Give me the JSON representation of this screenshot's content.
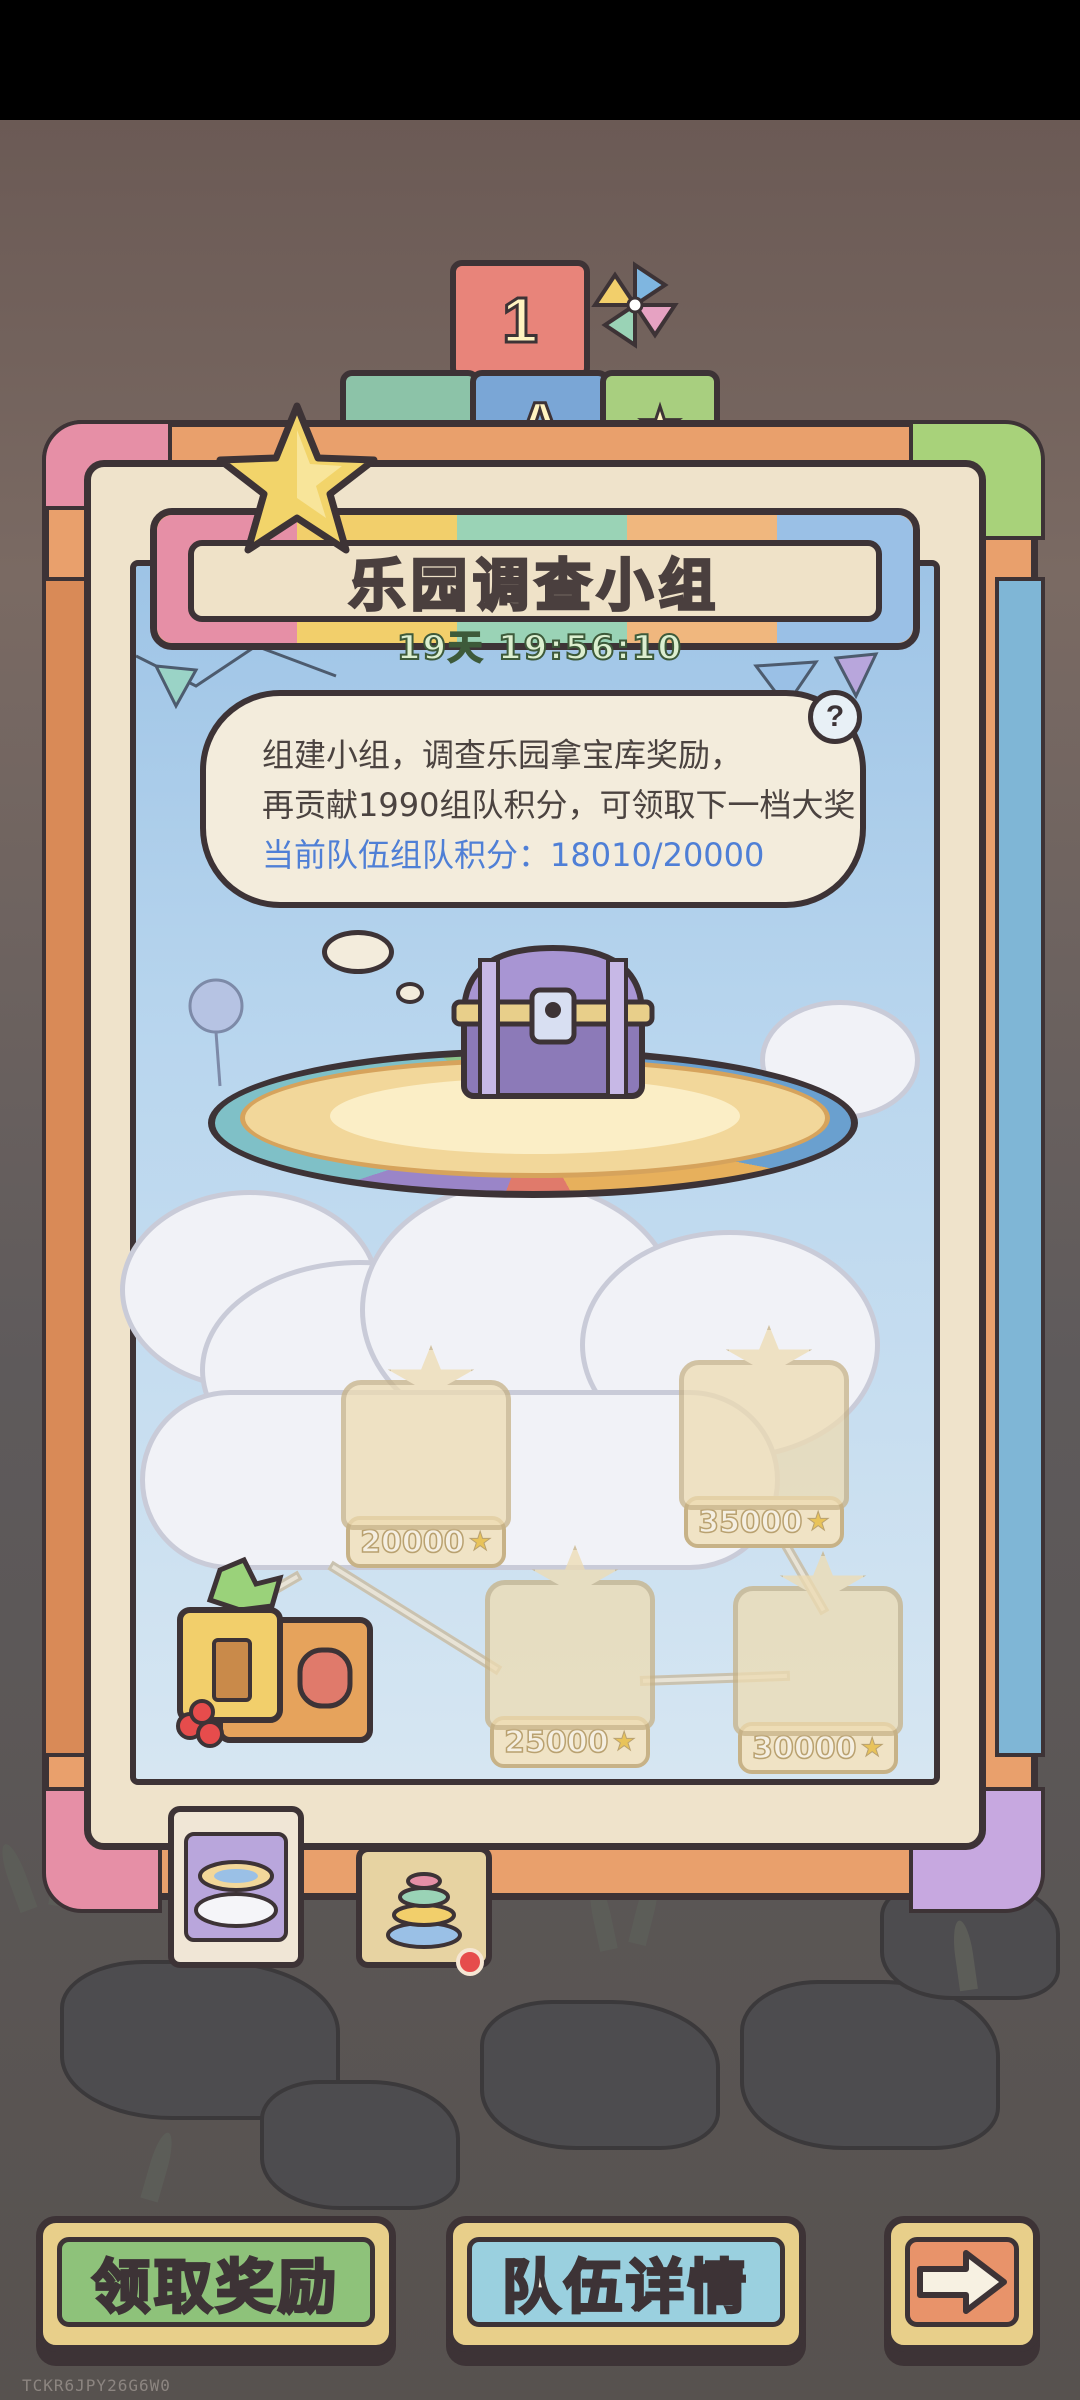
{
  "event": {
    "title": "乐园调查小组",
    "timer": "19天 19:56:10"
  },
  "info_bubble": {
    "line1": "组建小组，调查乐园拿宝库奖励，",
    "line2": "再贡献1990组队积分，可领取下一档大奖",
    "score_line": "当前队伍组队积分：18010/20000",
    "help_icon": "question-mark-icon",
    "help_glyph": "?"
  },
  "rewards": [
    {
      "points": "20000",
      "icon": "star-icon"
    },
    {
      "points": "35000",
      "icon": "star-icon"
    },
    {
      "points": "25000",
      "icon": "star-icon"
    },
    {
      "points": "30000",
      "icon": "star-icon"
    }
  ],
  "tabs": [
    {
      "icon": "cloud-ring-icon",
      "active": true
    },
    {
      "icon": "stacked-rings-icon",
      "active": false,
      "badge": "red-dot"
    }
  ],
  "blocks": {
    "number": "1",
    "letter": "A"
  },
  "buttons": {
    "claim": "领取奖励",
    "team": "队伍详情",
    "next_icon": "arrow-right-icon"
  },
  "device_id": "TCKR6JPY26G6W0",
  "colors": {
    "score_text": "#4f7fd6",
    "claim_button": "#8ec27a",
    "team_button": "#9ad0df",
    "next_button": "#e8936a",
    "badge": "#e64c4c"
  }
}
